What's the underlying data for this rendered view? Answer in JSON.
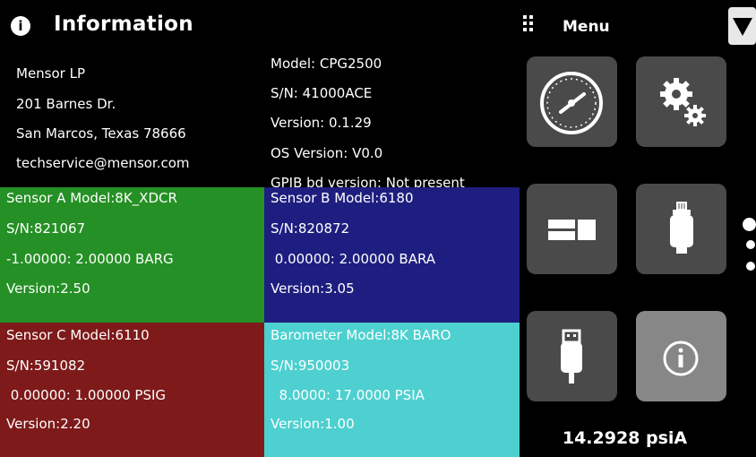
{
  "header": {
    "title": "Information",
    "title_icon": "info-icon"
  },
  "menu": {
    "label": "Menu",
    "grip_icon": "grip-icon",
    "dropdown_icon": "dropdown-arrow-icon"
  },
  "company": {
    "name": "Mensor LP",
    "street": "201 Barnes Dr.",
    "city": "San Marcos, Texas 78666",
    "email": "techservice@mensor.com"
  },
  "device": {
    "model": "Model: CPG2500",
    "serial": "S/N: 41000ACE",
    "version": "Version: 0.1.29",
    "os_version": "OS Version: V0.0",
    "gpib": "GPIB bd version:  Not present"
  },
  "sensors": [
    {
      "model": "Sensor A Model:8K_XDCR",
      "serial": "S/N:821067",
      "range": "-1.00000: 2.00000 BARG",
      "version": "Version:2.50",
      "color": "#259025"
    },
    {
      "model": "Sensor B Model:6180",
      "serial": "S/N:820872",
      "range": " 0.00000: 2.00000 BARA",
      "version": "Version:3.05",
      "color": "#1e1e80"
    },
    {
      "model": "Sensor C Model:6110",
      "serial": "S/N:591082",
      "range": " 0.00000: 1.00000 PSIG",
      "version": "Version:2.20",
      "color": "#7e1a1a"
    },
    {
      "model": "Barometer Model:8K BARO",
      "serial": "S/N:950003",
      "range": "  8.0000: 17.0000 PSIA",
      "version": "Version:1.00",
      "color": "#4dd0cf"
    }
  ],
  "tiles": [
    {
      "name": "gauge-icon"
    },
    {
      "name": "settings-gears-icon"
    },
    {
      "name": "display-layout-icon"
    },
    {
      "name": "sensor-transducer-icon"
    },
    {
      "name": "usb-icon"
    },
    {
      "name": "info-icon"
    }
  ],
  "reading": "14.2928 psiA",
  "page_indicator": {
    "pages": 3,
    "current": 1
  }
}
